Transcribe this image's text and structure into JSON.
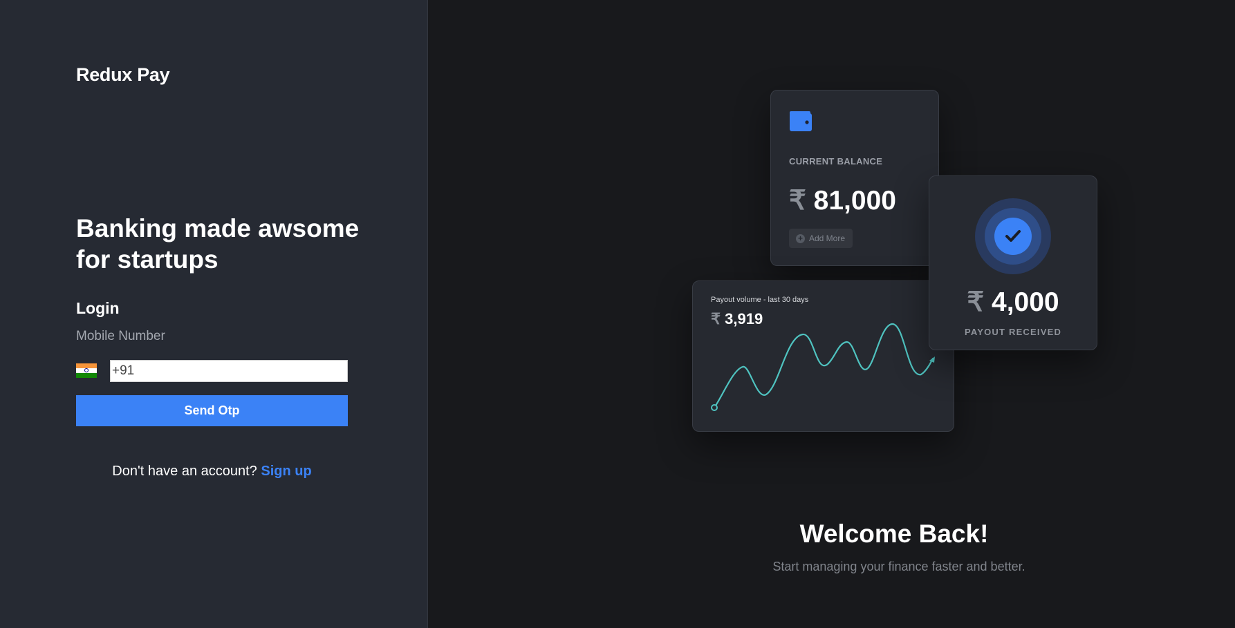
{
  "brand": {
    "name": "Redux Pay"
  },
  "hero": {
    "headline": "Banking made awsome for startups"
  },
  "login": {
    "title": "Login",
    "mobile_label": "Mobile Number",
    "phone_value": "+91",
    "send_button": "Send Otp",
    "signup_prompt": "Don't have an account?",
    "signup_link": "Sign up"
  },
  "cards": {
    "balance": {
      "label": "CURRENT BALANCE",
      "currency": "₹",
      "amount": "81,000",
      "add_more": "Add More"
    },
    "payout": {
      "currency": "₹",
      "amount": "4,000",
      "label": "PAYOUT RECEIVED"
    },
    "chart": {
      "title": "Payout volume - last 30 days",
      "currency": "₹",
      "amount": "3,919"
    }
  },
  "welcome": {
    "title": "Welcome Back!",
    "subtitle": "Start managing your finance faster and better."
  },
  "colors": {
    "accent": "#3b82f6",
    "chart_line": "#4fc3c0",
    "left_panel": "#262a33",
    "right_panel": "#18191c"
  },
  "icons": {
    "wallet": "wallet-icon",
    "check": "check-circle-icon",
    "plus": "plus-circle-icon",
    "flag": "india-flag-icon"
  }
}
